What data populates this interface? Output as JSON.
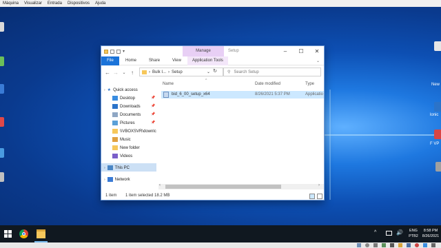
{
  "vbox_menu": [
    "Máquina",
    "Visualizar",
    "Entrada",
    "Dispositivos",
    "Ajuda"
  ],
  "desktop_labels": {
    "right_1": "New",
    "right_2": "lonic",
    "right_3": "F VP"
  },
  "explorer": {
    "title": "Setup",
    "contextual_tab": "Manage",
    "ribbon": {
      "file": "File",
      "tabs": [
        "Home",
        "Share",
        "View"
      ],
      "app_tools": "Application Tools"
    },
    "address": {
      "crumbs": [
        "Bulk I...",
        "Setup"
      ],
      "search_placeholder": "Search Setup"
    },
    "nav": {
      "quick_access": "Quick access",
      "items": [
        "Desktop",
        "Downloads",
        "Documents",
        "Pictures",
        "\\\\VBOXSVR\\downlc",
        "Music",
        "New folder",
        "Videos"
      ],
      "this_pc": "This PC",
      "network": "Network"
    },
    "columns": {
      "name": "Name",
      "date": "Date modified",
      "type": "Type"
    },
    "files": [
      {
        "name": "bid_6_00_setup_x64",
        "date": "8/26/2021 5:37 PM",
        "type": "Applicatio"
      }
    ],
    "status": {
      "count": "1 item",
      "selected": "1 item selected  18.2 MB"
    }
  },
  "taskbar": {
    "tray": {
      "lang_1": "ENG",
      "lang_2": "PTB2",
      "time": "8:58 PM",
      "date": "8/26/2021"
    }
  },
  "colors": {
    "accent": "#1a73d9",
    "manage_tab": "#e8cff5",
    "selection": "#cce8ff",
    "taskbar": "#101820"
  }
}
